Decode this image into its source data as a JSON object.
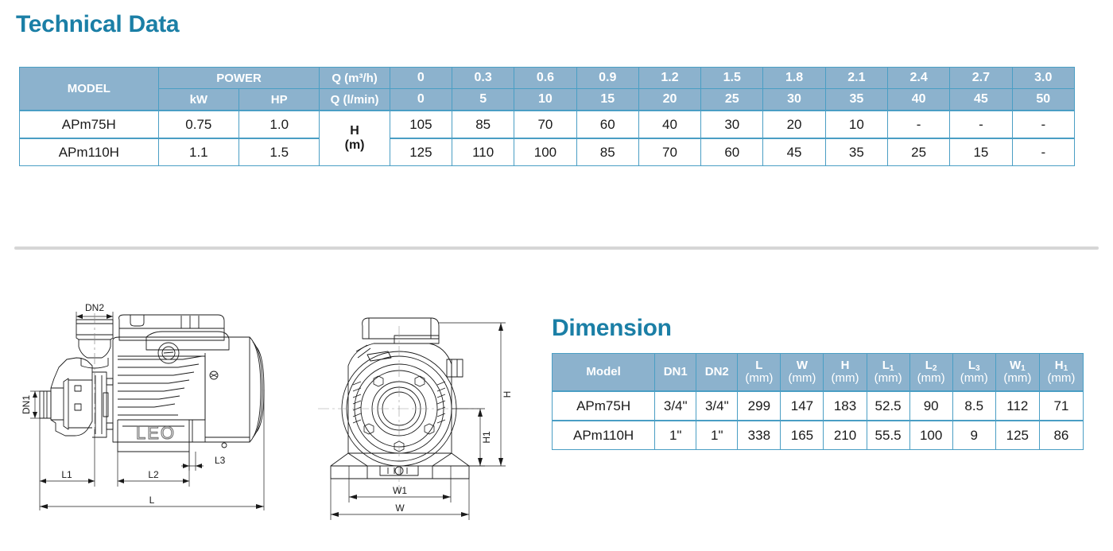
{
  "sections": {
    "technical": {
      "title": "Technical Data"
    },
    "dimension": {
      "title": "Dimension"
    }
  },
  "colors": {
    "title": "#1b7fa6",
    "header_bg": "#8cb2cd",
    "border": "#4a9ec4",
    "divider": "#d6d6d6",
    "text": "#1a1a1a"
  },
  "technical_table": {
    "headers": {
      "model": "MODEL",
      "power": "POWER",
      "kw": "kW",
      "hp": "HP",
      "q_m3h": "Q (m³/h)",
      "q_lmin": "Q (l/min)",
      "h_unit_line1": "H",
      "h_unit_line2": "(m)"
    },
    "flow_m3h": [
      "0",
      "0.3",
      "0.6",
      "0.9",
      "1.2",
      "1.5",
      "1.8",
      "2.1",
      "2.4",
      "2.7",
      "3.0"
    ],
    "flow_lmin": [
      "0",
      "5",
      "10",
      "15",
      "20",
      "25",
      "30",
      "35",
      "40",
      "45",
      "50"
    ],
    "rows": [
      {
        "model": "APm75H",
        "kw": "0.75",
        "hp": "1.0",
        "heads": [
          "105",
          "85",
          "70",
          "60",
          "40",
          "30",
          "20",
          "10",
          "-",
          "-",
          "-"
        ]
      },
      {
        "model": "APm110H",
        "kw": "1.1",
        "hp": "1.5",
        "heads": [
          "125",
          "110",
          "100",
          "85",
          "70",
          "60",
          "45",
          "35",
          "25",
          "15",
          "-"
        ]
      }
    ]
  },
  "dimension_table": {
    "headers": [
      {
        "label": "Model",
        "sub": "",
        "unit": ""
      },
      {
        "label": "DN1",
        "sub": "",
        "unit": ""
      },
      {
        "label": "DN2",
        "sub": "",
        "unit": ""
      },
      {
        "label": "L",
        "sub": "",
        "unit": "(mm)"
      },
      {
        "label": "W",
        "sub": "",
        "unit": "(mm)"
      },
      {
        "label": "H",
        "sub": "",
        "unit": "(mm)"
      },
      {
        "label": "L",
        "sub": "1",
        "unit": "(mm)"
      },
      {
        "label": "L",
        "sub": "2",
        "unit": "(mm)"
      },
      {
        "label": "L",
        "sub": "3",
        "unit": "(mm)"
      },
      {
        "label": "W",
        "sub": "1",
        "unit": "(mm)"
      },
      {
        "label": "H",
        "sub": "1",
        "unit": "(mm)"
      }
    ],
    "rows": [
      {
        "model": "APm75H",
        "values": [
          "3/4\"",
          "3/4\"",
          "299",
          "147",
          "183",
          "52.5",
          "90",
          "8.5",
          "112",
          "71"
        ]
      },
      {
        "model": "APm110H",
        "values": [
          "1\"",
          "1\"",
          "338",
          "165",
          "210",
          "55.5",
          "100",
          "9",
          "125",
          "86"
        ]
      }
    ]
  },
  "drawings": {
    "side_view": {
      "brand": "LEO",
      "labels": {
        "dn1": "DN1",
        "dn2": "DN2",
        "l": "L",
        "l1": "L1",
        "l2": "L2",
        "l3": "L3"
      }
    },
    "front_view": {
      "labels": {
        "h": "H",
        "h1": "H1",
        "w": "W",
        "w1": "W1"
      }
    }
  }
}
